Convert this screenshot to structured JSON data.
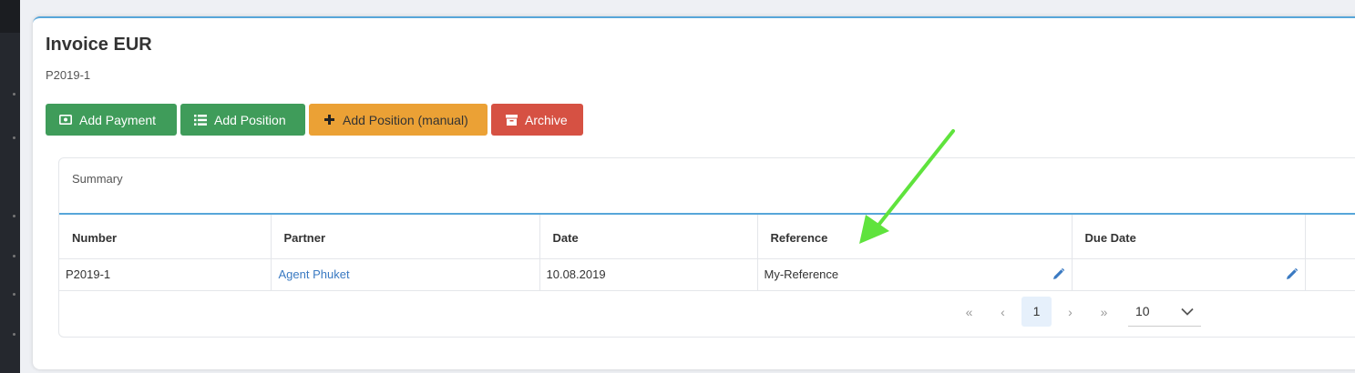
{
  "page": {
    "title": "Invoice EUR",
    "subtitle": "P2019-1"
  },
  "toolbar": {
    "add_payment": "Add Payment",
    "add_position": "Add Position",
    "add_position_manual": "Add Position (manual)",
    "archive": "Archive"
  },
  "summary": {
    "title": "Summary",
    "columns": [
      "Number",
      "Partner",
      "Date",
      "Reference",
      "Due Date",
      ""
    ],
    "rows": [
      {
        "number": "P2019-1",
        "partner": "Agent Phuket",
        "date": "10.08.2019",
        "reference": "My-Reference",
        "due_date": ""
      }
    ]
  },
  "pagination": {
    "first": "«",
    "prev": "‹",
    "current_page": "1",
    "next": "›",
    "last": "»",
    "page_size": "10"
  },
  "colors": {
    "green": "#3f9c5a",
    "orange": "#eba135",
    "red": "#d65143",
    "accent": "#57a6d9",
    "link": "#3a7ac2",
    "annotation_arrow": "#5fe33d"
  },
  "icons": {
    "add_payment": "money-icon",
    "add_position": "list-icon",
    "add_position_manual": "plus-icon",
    "archive": "archive-icon",
    "edit": "pencil-icon"
  }
}
